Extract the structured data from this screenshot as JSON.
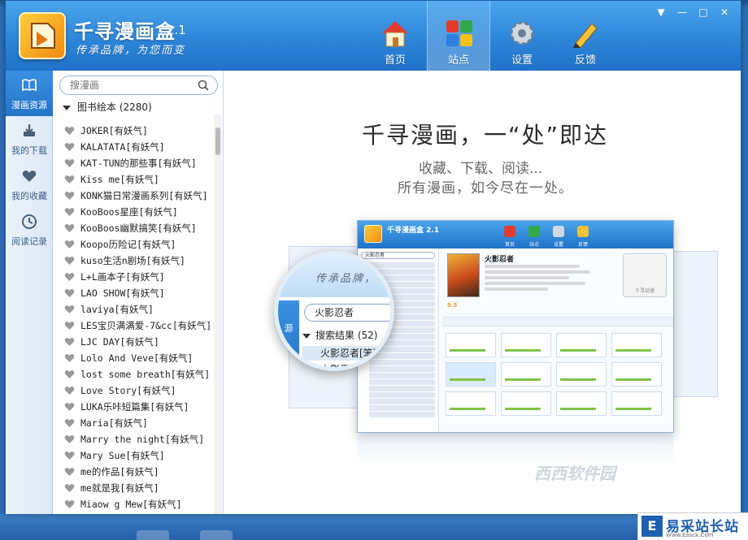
{
  "app": {
    "name": "千寻漫画盒",
    "version": "2.1",
    "slogan": "传承品牌，为您而变"
  },
  "nav": [
    {
      "label": "首页",
      "icon": "home-icon"
    },
    {
      "label": "站点",
      "icon": "sites-icon"
    },
    {
      "label": "设置",
      "icon": "gear-icon"
    },
    {
      "label": "反馈",
      "icon": "pencil-icon"
    }
  ],
  "window_controls": {
    "menu": "▼",
    "minimize": "—",
    "maximize": "□",
    "close": "✕"
  },
  "rail": [
    {
      "label": "漫画资源",
      "icon": "book-icon",
      "active": true
    },
    {
      "label": "我的下载",
      "icon": "download-icon"
    },
    {
      "label": "我的收藏",
      "icon": "heart-icon"
    },
    {
      "label": "阅读记录",
      "icon": "clock-icon"
    }
  ],
  "search": {
    "placeholder": "搜漫画"
  },
  "category": {
    "label": "图书绘本 (2280)"
  },
  "list": [
    "JOKER[有妖气]",
    "KALATATA[有妖气]",
    "KAT-TUN的那些事[有妖气]",
    "Kiss  me[有妖气]",
    "KONK猫日常漫画系列[有妖气]",
    "KooBoos星座[有妖气]",
    "KooBoos幽默搞笑[有妖气]",
    "Koopo历险记[有妖气]",
    "kuso生活n剧场[有妖气]",
    "L+L画本子[有妖气]",
    "LAO SHOW[有妖气]",
    "laviya[有妖气]",
    "LES宝贝满满爱-7&cc[有妖气]",
    "LJC DAY[有妖气]",
    "Lolo And Veve[有妖气]",
    "lost some breath[有妖气]",
    "Love Story[有妖气]",
    "LUKA乐咔短篇集[有妖气]",
    "Maria[有妖气]",
    "Marry the night[有妖气]",
    "Mary Sue[有妖气]",
    "me的作品[有妖气]",
    "me就是我[有妖气]",
    "Miaow g Mew[有妖气]"
  ],
  "main": {
    "headline": "千寻漫画，一“处”即达",
    "sub1": "收藏、下载、阅读...",
    "sub2": "所有漫画，如今尽在一处。"
  },
  "preview": {
    "title": "千寻漫画盒 2.1",
    "nav": [
      "首页",
      "站点",
      "设置",
      "反馈"
    ],
    "search_value": "火影忍者",
    "manga_name": "火影忍者",
    "score": "9.5",
    "badge": "千寻动漫"
  },
  "lens": {
    "slogan": "传承品牌，",
    "search_value": "火影忍者",
    "results_label": "搜索结果 (52)",
    "item1": "火影忍者[笨狗",
    "item2": "火影忍者",
    "side_label": "源"
  },
  "watermark": "西西软件园",
  "site_badge": {
    "name": "易采站长站",
    "url": "Www.Easck.Com"
  },
  "colors": {
    "accent": "#2d86d9",
    "rail_active": "#2474c8",
    "score": "#f39a1a"
  }
}
